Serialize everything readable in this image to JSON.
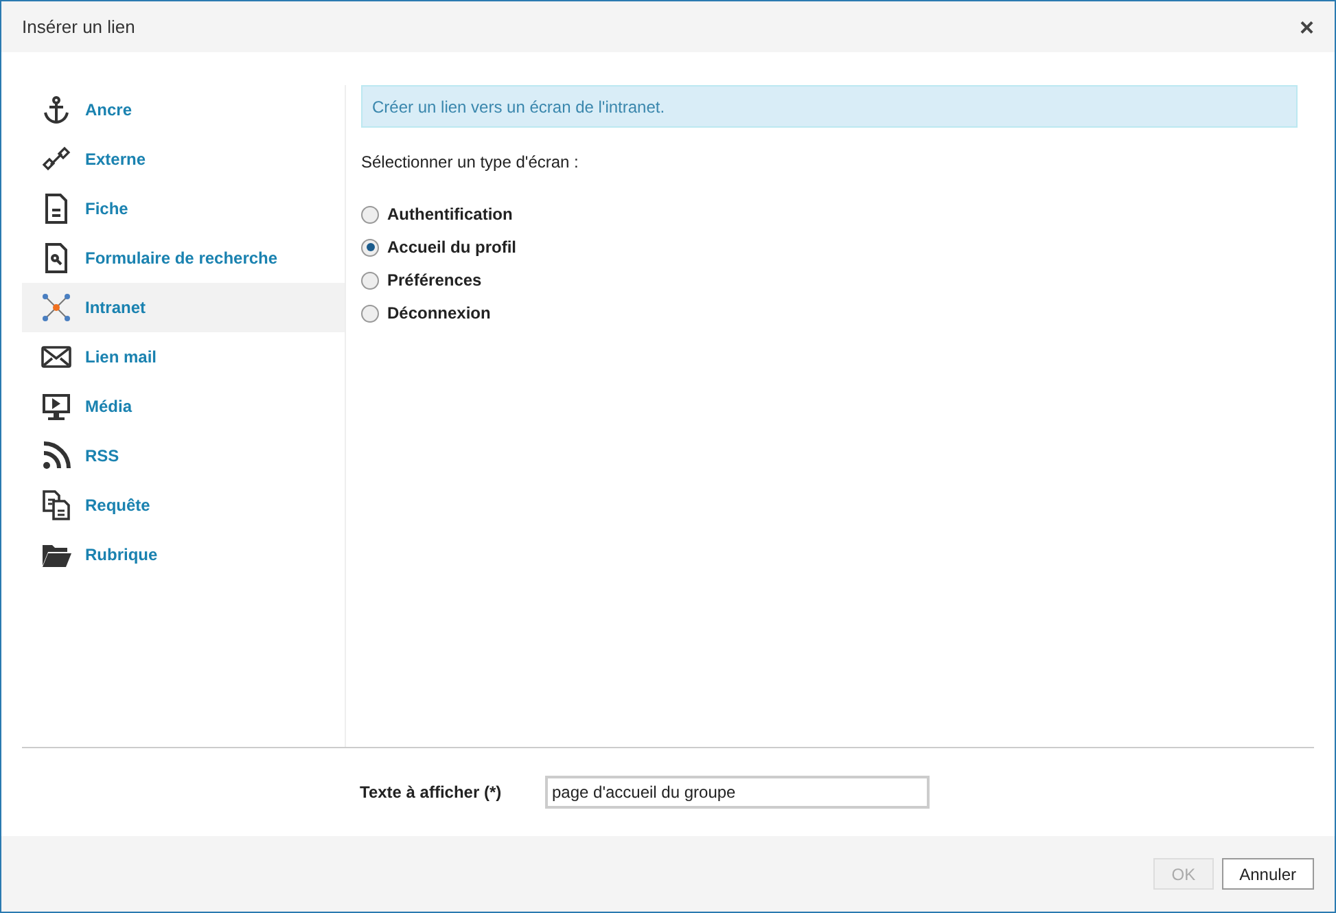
{
  "window": {
    "title": "Insérer un lien",
    "close": "×"
  },
  "sidebar": {
    "items": [
      {
        "label": "Ancre",
        "selected": false
      },
      {
        "label": "Externe",
        "selected": false
      },
      {
        "label": "Fiche",
        "selected": false
      },
      {
        "label": "Formulaire de recherche",
        "selected": false
      },
      {
        "label": "Intranet",
        "selected": true
      },
      {
        "label": "Lien mail",
        "selected": false
      },
      {
        "label": "Média",
        "selected": false
      },
      {
        "label": "RSS",
        "selected": false
      },
      {
        "label": "Requête",
        "selected": false
      },
      {
        "label": "Rubrique",
        "selected": false
      }
    ]
  },
  "info": "Créer un lien vers un écran de l'intranet.",
  "prompt": "Sélectionner un type d'écran :",
  "options": [
    {
      "label": "Authentification",
      "selected": false
    },
    {
      "label": "Accueil du profil",
      "selected": true
    },
    {
      "label": "Préférences",
      "selected": false
    },
    {
      "label": "Déconnexion",
      "selected": false
    }
  ],
  "text_field": {
    "label": "Texte à afficher (*)",
    "value": "page d'accueil du groupe"
  },
  "buttons": [
    {
      "label": "OK",
      "disabled": true
    },
    {
      "label": "Annuler",
      "disabled": false
    }
  ]
}
